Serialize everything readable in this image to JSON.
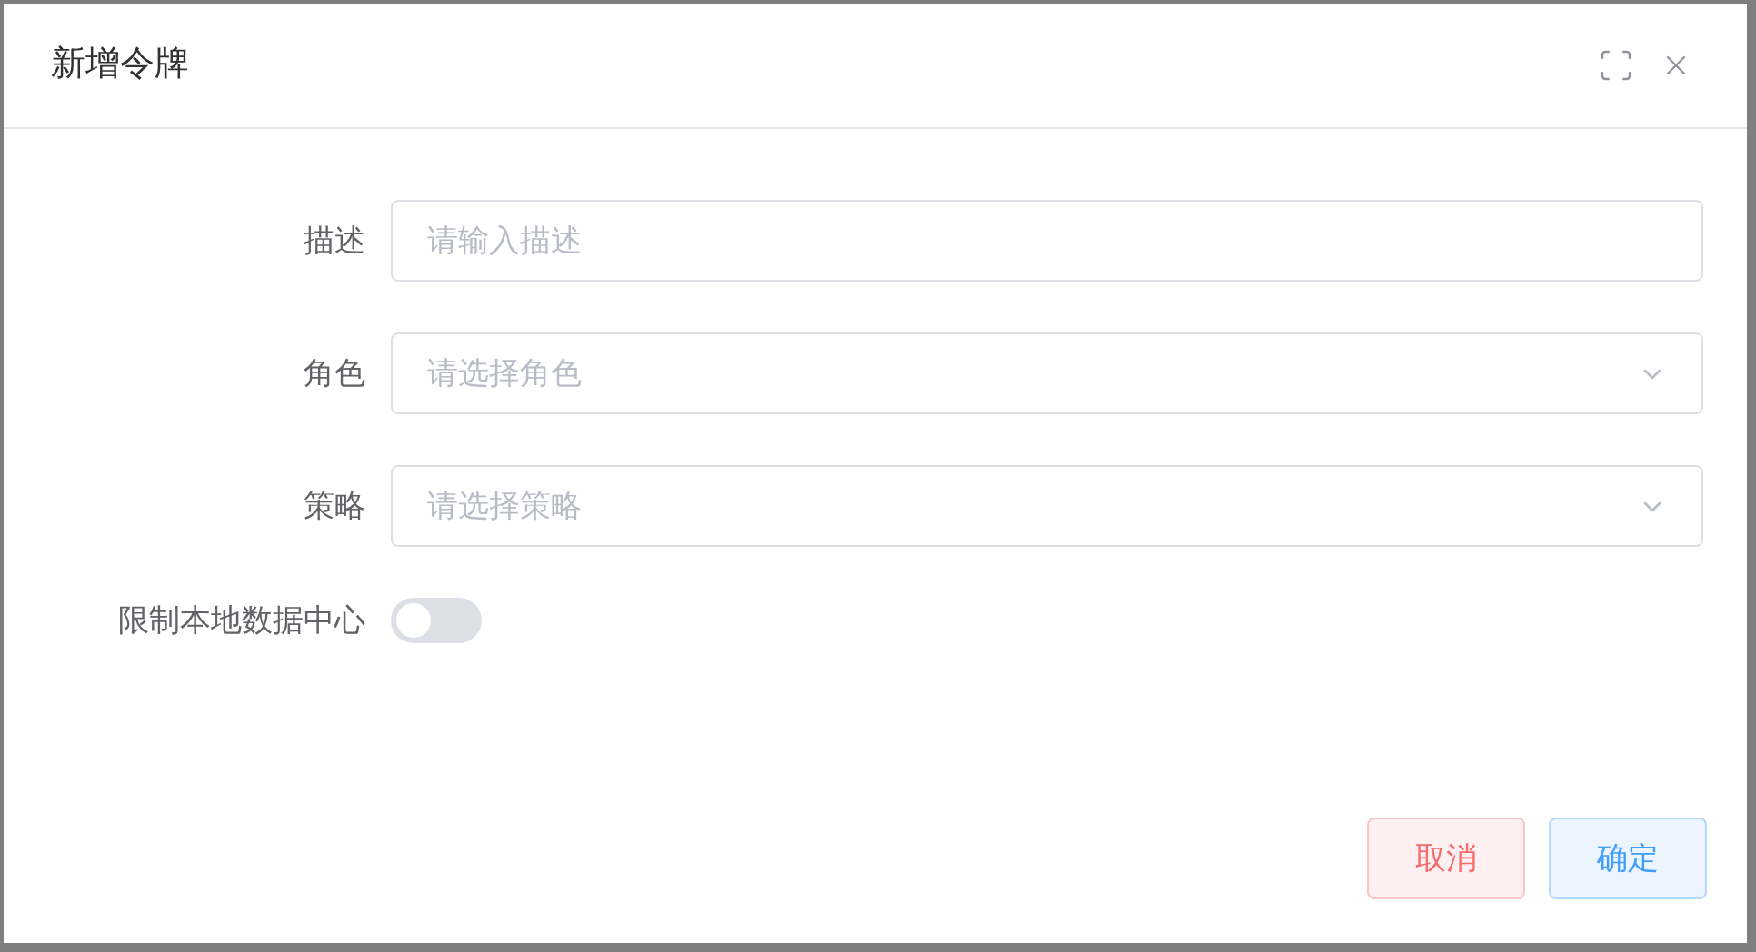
{
  "dialog": {
    "title": "新增令牌",
    "fields": [
      {
        "kind": "input",
        "label": "描述",
        "placeholder": "请输入描述"
      },
      {
        "kind": "select",
        "label": "角色",
        "placeholder": "请选择角色"
      },
      {
        "kind": "select",
        "label": "策略",
        "placeholder": "请选择策略"
      },
      {
        "kind": "switch",
        "label": "限制本地数据中心",
        "on": false
      }
    ],
    "buttons": [
      {
        "kind": "cancel",
        "label": "取消"
      },
      {
        "kind": "confirm",
        "label": "确定"
      }
    ]
  }
}
